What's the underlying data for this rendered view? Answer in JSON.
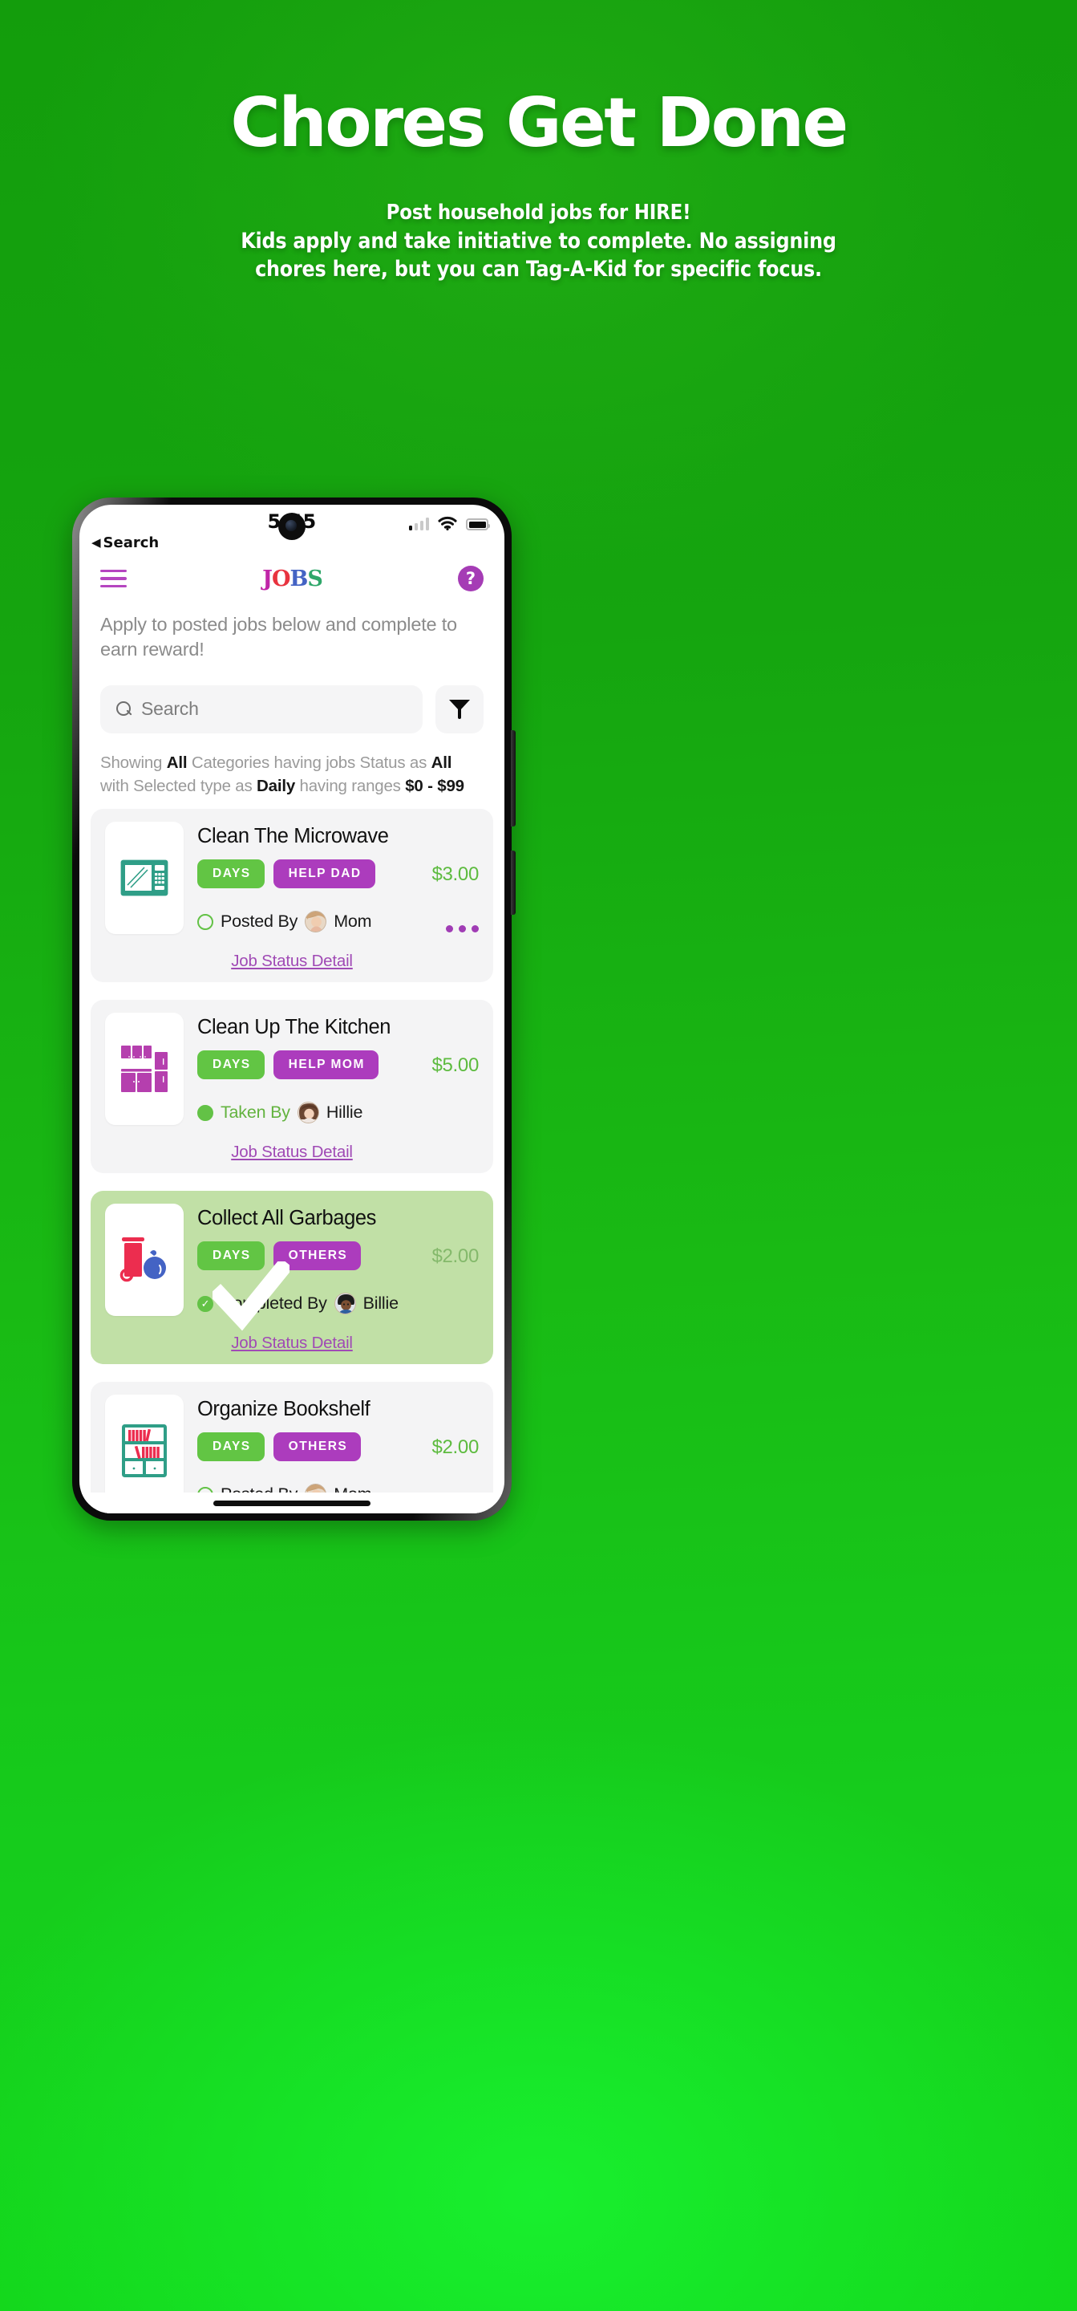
{
  "promo": {
    "title": "Chores Get Done",
    "subtitle_line1": "Post household jobs for HIRE!",
    "subtitle_line2": "Kids apply and take initiative to complete. No assigning",
    "subtitle_line3": "chores here, but you can Tag-A-Kid for specific focus.",
    "bg_color": "#17b514",
    "title_color": "#ffffff"
  },
  "status_bar": {
    "time": "5:45",
    "back_label": "Search",
    "back_caret": "◀",
    "signal_icon": "cellular-signal-icon",
    "wifi_icon": "wifi-icon",
    "battery_icon": "battery-full-icon"
  },
  "app_header": {
    "menu_icon": "hamburger-menu-icon",
    "logo": {
      "j": "J",
      "o": "O",
      "b": "B",
      "s": "S"
    },
    "help_label": "?",
    "help_icon": "help-circle-icon",
    "accent_purple": "#a53cb5"
  },
  "intro": "Apply to posted jobs below and complete to earn reward!",
  "search": {
    "placeholder": "Search",
    "icon": "search-icon",
    "filter_icon": "filter-funnel-icon"
  },
  "summary": {
    "p1": "Showing",
    "v1": "All",
    "p2": "Categories having jobs Status as",
    "v2": "All",
    "p3": "with Selected type as",
    "v3": "Daily",
    "p4": "having ranges",
    "v4": "$0 - $99"
  },
  "jobs": [
    {
      "title": "Clean The Microwave",
      "icon": "microwave-icon",
      "icon_color": "#2f9e87",
      "badge_type": "DAYS",
      "badge_cat": "HELP DAD",
      "price": "$3.00",
      "status_label": "Posted By",
      "status_kind": "posted",
      "person": "Mom",
      "avatar": "mom-avatar",
      "link": "Job Status Detail",
      "has_more": true,
      "completed": false
    },
    {
      "title": "Clean Up The Kitchen",
      "icon": "kitchen-cabinets-icon",
      "icon_color": "#b53fae",
      "badge_type": "DAYS",
      "badge_cat": "HELP MOM",
      "price": "$5.00",
      "status_label": "Taken By",
      "status_kind": "taken",
      "person": "Hillie",
      "avatar": "hillie-avatar",
      "link": "Job Status Detail",
      "has_more": false,
      "completed": false
    },
    {
      "title": "Collect All Garbages",
      "icon": "garbage-bin-icon",
      "icon_color": "#ec2d4f",
      "badge_type": "DAYS",
      "badge_cat": "OTHERS",
      "price": "$2.00",
      "status_label": "Completed By",
      "status_kind": "completed",
      "person": "Billie",
      "avatar": "billie-avatar",
      "link": "Job Status Detail",
      "has_more": false,
      "completed": true
    },
    {
      "title": "Organize Bookshelf",
      "icon": "bookshelf-icon",
      "icon_color": "#2f9e87",
      "badge_type": "DAYS",
      "badge_cat": "OTHERS",
      "price": "$2.00",
      "status_label": "Posted By",
      "status_kind": "posted",
      "person": "Mom",
      "avatar": "mom-avatar",
      "link": "",
      "has_more": true,
      "completed": false
    }
  ],
  "colors": {
    "badge_green": "#62c544",
    "badge_purple": "#ac3cbd",
    "price_green": "#5dbb3f",
    "link_purple": "#a04ab5",
    "card_bg": "#f4f4f5",
    "card_done_bg": "#c1e0a6"
  }
}
